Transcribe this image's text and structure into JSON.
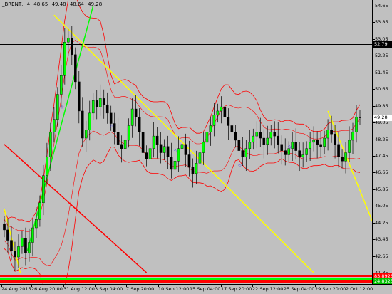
{
  "window": {
    "symbol": "_BRENT,H4",
    "ohlc": [
      "48.65",
      "49.48",
      "48.64",
      "49.28"
    ]
  },
  "price_axis": {
    "labels": [
      "54.65",
      "53.85",
      "53.05",
      "52.25",
      "51.45",
      "50.65",
      "49.85",
      "49.05",
      "48.25",
      "47.45",
      "46.65",
      "45.85",
      "45.05",
      "44.25",
      "43.45",
      "42.65",
      "41.85"
    ],
    "flags": [
      {
        "value": "52.79",
        "bg": "#000000",
        "fg": "#ffffff"
      },
      {
        "value": "49.28",
        "bg": "#ffffff",
        "fg": "#000000"
      },
      {
        "value": "83.8926",
        "bg": "#ff0000",
        "fg": "#ffffff"
      },
      {
        "value": "24.8323",
        "bg": "#00c000",
        "fg": "#ffffff"
      }
    ]
  },
  "time_axis": {
    "labels": [
      "24 Aug 2015",
      "26 Aug 20:00",
      "31 Aug 12:00",
      "3 Sep 04:00",
      "7 Sep 20:00",
      "10 Sep 12:00",
      "15 Sep 04:00",
      "17 Sep 20:00",
      "22 Sep 12:00",
      "25 Sep 04:00",
      "29 Sep 20:00",
      "2 Oct 12:00"
    ]
  },
  "colors": {
    "background": "#c0c0c0",
    "bull_candle": "#00ff00",
    "bear_candle": "#000000",
    "bands": "#ff0000",
    "trendline_yellow": "#ffff00",
    "trendline_green": "#00ff00",
    "trendline_red": "#ff0000",
    "hline": "#000000",
    "fractal": "#0000ff"
  },
  "chart_data": {
    "type": "candlestick",
    "instrument": "_BRENT",
    "timeframe": "H4",
    "ylim": [
      41.85,
      54.65
    ],
    "horizontal_line": 52.79,
    "last_price": 49.28,
    "closes": [
      43.9,
      43.4,
      42.9,
      42.6,
      43.1,
      43.5,
      42.8,
      43.3,
      44.0,
      44.4,
      45.2,
      46.5,
      47.4,
      48.6,
      49.2,
      50.4,
      51.3,
      52.9,
      53.1,
      52.3,
      51.0,
      49.6,
      48.3,
      48.7,
      49.5,
      50.1,
      49.8,
      50.2,
      49.9,
      49.5,
      49.0,
      48.6,
      48.0,
      47.8,
      48.2,
      48.9,
      49.7,
      49.3,
      48.6,
      47.6,
      47.3,
      47.8,
      48.4,
      48.0,
      47.6,
      47.9,
      47.4,
      46.8,
      47.2,
      47.8,
      48.0,
      47.5,
      46.9,
      46.6,
      47.1,
      47.6,
      48.1,
      48.6,
      48.9,
      49.4,
      49.6,
      49.8,
      49.3,
      48.9,
      48.6,
      48.2,
      47.7,
      47.4,
      47.8,
      48.1,
      48.4,
      48.6,
      48.3,
      48.0,
      48.3,
      48.6,
      48.4,
      48.0,
      47.7,
      47.5,
      47.8,
      48.1,
      47.7,
      47.4,
      47.5,
      47.8,
      48.1,
      48.2,
      48.0,
      47.9,
      48.3,
      48.7,
      48.5,
      48.0,
      47.4,
      47.2,
      47.6,
      48.2,
      48.6,
      49.3,
      49.28
    ],
    "trendlines": [
      {
        "color": "yellow",
        "from": {
          "x": "26 Aug 12:00",
          "y": 54.2
        },
        "to": {
          "x": "29 Sep 12:00",
          "y": 41.85
        }
      },
      {
        "color": "yellow",
        "from": {
          "x": "30 Sep 12:00",
          "y": 49.6
        },
        "to": {
          "x": "3 Oct 12:00",
          "y": 44.1
        }
      },
      {
        "color": "yellow",
        "from": {
          "x": "24 Aug 2015",
          "y": 44.9
        },
        "to": {
          "x": "25 Aug 04:00",
          "y": 41.85
        }
      },
      {
        "color": "green",
        "from": {
          "x": "25 Aug 12:00",
          "y": 42.9
        },
        "to": {
          "x": "29 Aug 20:00",
          "y": 54.65
        }
      },
      {
        "color": "red",
        "from": {
          "x": "24 Aug 2015",
          "y": 48.0
        },
        "to": {
          "x": "9 Sep 20:00",
          "y": 41.85
        }
      }
    ]
  }
}
